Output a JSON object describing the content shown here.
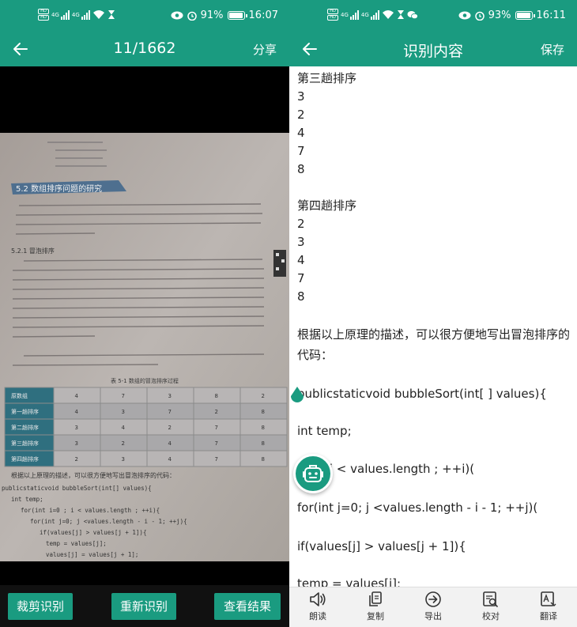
{
  "left_screen": {
    "status": {
      "battery_percent": "91%",
      "time": "16:07",
      "hd_labels": [
        "HD",
        "HD"
      ],
      "signal_labels": [
        "4G",
        "4G"
      ]
    },
    "header": {
      "counter": "11/1662",
      "share_label": "分享"
    },
    "buttons": {
      "crop": "裁剪识别",
      "redo": "重新识别",
      "view": "查看结果"
    },
    "photo": {
      "section_heading": "5.2  数组排序问题的研究",
      "subsection_heading": "5.2.1  冒泡排序",
      "table_caption": "表 5-1  数组的冒泡排序过程",
      "table_rows": [
        {
          "label": "原数组",
          "values": [
            "4",
            "7",
            "3",
            "8",
            "2"
          ]
        },
        {
          "label": "第一趟排序",
          "values": [
            "4",
            "3",
            "7",
            "2",
            "8"
          ]
        },
        {
          "label": "第二趟排序",
          "values": [
            "3",
            "4",
            "2",
            "7",
            "8"
          ]
        },
        {
          "label": "第三趟排序",
          "values": [
            "3",
            "2",
            "4",
            "7",
            "8"
          ]
        },
        {
          "label": "第四趟排序",
          "values": [
            "2",
            "3",
            "4",
            "7",
            "8"
          ]
        }
      ],
      "after_table": "根据以上原理的描述，可以很方便地写出冒泡排序的代码：",
      "code_lines": [
        "publicstaticvoid bubbleSort(int[] values){",
        "int temp;",
        "for(int i=0 ; i < values.length ; ++i){",
        "for(int j=0; j <values.length - i - 1; ++j){",
        "if(values[j] > values[j + 1]){",
        "temp = values[j];",
        "values[j] = values[j + 1];"
      ]
    }
  },
  "right_screen": {
    "status": {
      "battery_percent": "93%",
      "time": "16:11",
      "hd_labels": [
        "HD",
        "HD"
      ],
      "signal_labels": [
        "4G",
        "4G"
      ]
    },
    "header": {
      "title": "识别内容",
      "save_label": "保存"
    },
    "content_lines": [
      "第三趟排序",
      "3",
      "2",
      "4",
      "7",
      "8",
      "",
      "第四趟排序",
      "2",
      "3",
      "4",
      "7",
      "8",
      "",
      "根据以上原理的描述，可以很方便地写出冒泡排序的代码：",
      "",
      "publicstaticvoid bubbleSort(int[ ] values){",
      "",
      "int temp;",
      "",
      "i=0 ; i < values.length ; ++i)(",
      "",
      "for(int j=0; j <values.length - i - 1; ++j)(",
      "",
      "if(values[j] > values[j + 1]){",
      "",
      "temp = values[j];"
    ],
    "toolbar": [
      {
        "label": "朗读",
        "icon": "speaker-icon"
      },
      {
        "label": "复制",
        "icon": "copy-icon"
      },
      {
        "label": "导出",
        "icon": "export-icon"
      },
      {
        "label": "校对",
        "icon": "proofread-icon"
      },
      {
        "label": "翻译",
        "icon": "translate-icon"
      }
    ]
  },
  "colors": {
    "accent": "#1a9b80",
    "photo_bg": "#000000"
  }
}
